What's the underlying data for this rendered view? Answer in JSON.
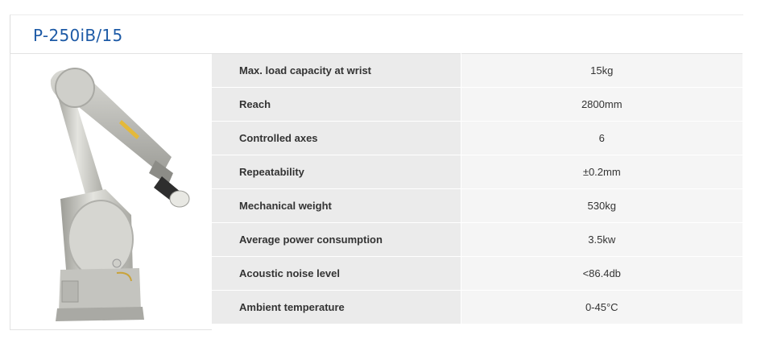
{
  "product": {
    "title": "P-250iB/15",
    "image_alt": "robot-arm-photo"
  },
  "colors": {
    "title": "#1d5aa6",
    "label_bg": "#ebebeb",
    "value_bg": "#f5f5f5"
  },
  "specs": [
    {
      "label": "Max. load capacity at wrist",
      "value": "15kg"
    },
    {
      "label": "Reach",
      "value": "2800mm"
    },
    {
      "label": "Controlled axes",
      "value": "6"
    },
    {
      "label": "Repeatability",
      "value": "±0.2mm"
    },
    {
      "label": "Mechanical weight",
      "value": "530kg"
    },
    {
      "label": "Average power consumption",
      "value": "3.5kw"
    },
    {
      "label": "Acoustic noise level",
      "value": "<86.4db"
    },
    {
      "label": "Ambient temperature",
      "value": "0-45°C"
    }
  ]
}
